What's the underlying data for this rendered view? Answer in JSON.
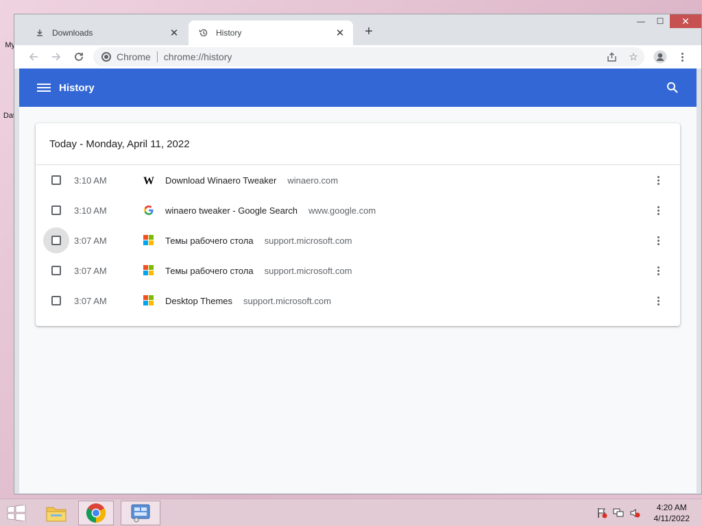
{
  "desktop": {
    "icon_labels": [
      "My",
      "Dat"
    ]
  },
  "browser": {
    "tabs": [
      {
        "label": "Downloads",
        "icon": "download-icon",
        "active": false
      },
      {
        "label": "History",
        "icon": "history-icon",
        "active": true
      }
    ],
    "omnibox": {
      "site_label": "Chrome",
      "url": "chrome://history"
    }
  },
  "history_page": {
    "title": "History",
    "day_header": "Today - Monday, April 11, 2022",
    "entries": [
      {
        "time": "3:10 AM",
        "title": "Download Winaero Tweaker",
        "domain": "winaero.com",
        "favicon": "winaero-icon"
      },
      {
        "time": "3:10 AM",
        "title": "winaero tweaker - Google Search",
        "domain": "www.google.com",
        "favicon": "google-icon"
      },
      {
        "time": "3:07 AM",
        "title": "Темы рабочего стола",
        "domain": "support.microsoft.com",
        "favicon": "microsoft-icon"
      },
      {
        "time": "3:07 AM",
        "title": "Темы рабочего стола",
        "domain": "support.microsoft.com",
        "favicon": "microsoft-icon"
      },
      {
        "time": "3:07 AM",
        "title": "Desktop Themes",
        "domain": "support.microsoft.com",
        "favicon": "microsoft-icon"
      }
    ],
    "accent_color": "#3367d6"
  },
  "taskbar": {
    "clock_time": "4:20 AM",
    "clock_date": "4/11/2022"
  }
}
